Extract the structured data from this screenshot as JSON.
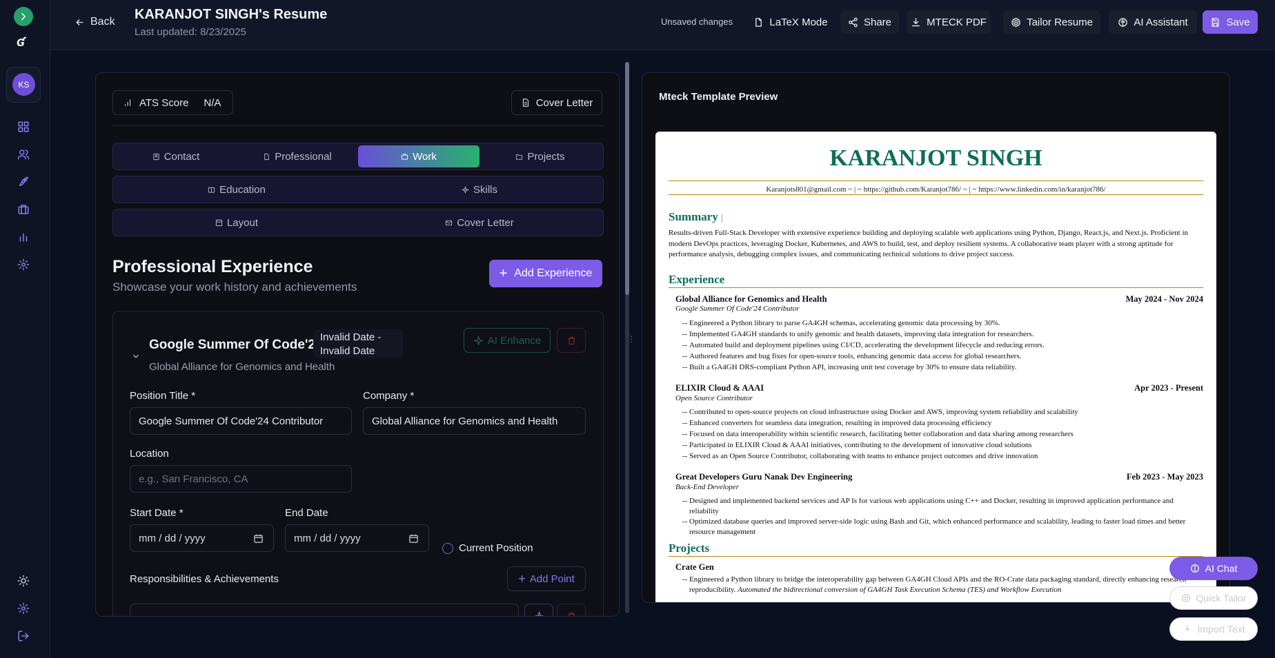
{
  "header": {
    "back_label": "Back",
    "title": "KARANJOT SINGH's Resume",
    "subtitle": "Last updated: 8/23/2025",
    "unsaved": "Unsaved changes",
    "latex_label": "LaTeX Mode",
    "share_label": "Share",
    "pdf_label": "MTECK PDF",
    "tailor_label": "Tailor Resume",
    "ai_label": "AI Assistant",
    "save_label": "Save"
  },
  "rail": {
    "avatar": "KS"
  },
  "editor": {
    "ats_label": "ATS Score",
    "ats_value": "N/A",
    "cover_letter_button": "Cover Letter",
    "tabs_row1": [
      "Contact",
      "Professional",
      "Work",
      "Projects"
    ],
    "tabs_row2": [
      "Education",
      "Skills"
    ],
    "tabs_row3": [
      "Layout",
      "Cover Letter"
    ],
    "active_tab": "Work",
    "section_title": "Professional Experience",
    "section_subtitle": "Showcase your work history and achievements",
    "add_experience": "Add Experience",
    "card": {
      "title": "Google Summer Of Code'24 ...",
      "subtitle": "Global Alliance for Genomics and Health",
      "date_range": "Invalid Date - Invalid Date",
      "ai_enhance": "AI Enhance",
      "position_label": "Position Title *",
      "position_value": "Google Summer Of Code'24 Contributor",
      "company_label": "Company *",
      "company_value": "Global Alliance for Genomics and Health",
      "location_label": "Location",
      "location_placeholder": "e.g., San Francisco, CA",
      "start_label": "Start Date *",
      "start_placeholder": "mm / dd / yyyy",
      "end_label": "End Date",
      "end_placeholder": "mm / dd / yyyy",
      "current_label": "Current Position",
      "resp_label": "Responsibilities & Achievements",
      "add_point": "Add Point"
    }
  },
  "preview": {
    "title": "Mteck Template Preview",
    "name": "KARANJOT SINGH",
    "contact": "Karanjots801@gmail.com ~ | ~ https://github.com/Karanjot786/ ~ | ~ https://www.linkedin.com/in/karanjot786/",
    "summary_heading": "Summary",
    "summary": "Results-driven Full-Stack Developer with extensive experience building and deploying scalable web applications using Python, Django, React.js, and Next.js. Proficient in modern DevOps practices, leveraging Docker, Kubernetes, and AWS to build, test, and deploy resilient systems. A collaborative team player with a strong aptitude for performance analysis, debugging complex issues, and communicating technical solutions to drive project success.",
    "experience_heading": "Experience",
    "jobs": [
      {
        "org": "Global Alliance for Genomics and Health",
        "dates": "May 2024 - Nov 2024",
        "role": "Google Summer Of Code'24 Contributor",
        "bullets": [
          "Engineered a Python library to parse GA4GH schemas, accelerating genomic data processing by 30%.",
          "Implemented GA4GH standards to unify genomic and health datasets, improving data integration for researchers.",
          "Automated build and deployment pipelines using CI/CD, accelerating the development lifecycle and reducing errors.",
          "Authored features and bug fixes for open-source tools, enhancing genomic data access for global researchers.",
          "Built a GA4GH DRS-compliant Python API, increasing unit test coverage by 30% to ensure data reliability."
        ]
      },
      {
        "org": "ELIXIR Cloud & AAAI",
        "dates": "Apr 2023 - Present",
        "role": "Open Source Contributor",
        "bullets": [
          "Contributed to open-source projects on cloud infrastructure using Docker and AWS, improving system reliability and scalability",
          "Enhanced converters for seamless data integration, resulting in improved data processing efficiency",
          "Focused on data interoperability within scientific research, facilitating better collaboration and data sharing among researchers",
          "Participated in ELIXIR Cloud & AAAI initiatives, contributing to the development of innovative cloud solutions",
          "Served as an Open Source Contributor, collaborating with teams to enhance project outcomes and drive innovation"
        ]
      },
      {
        "org": "Great Developers Guru Nanak Dev Engineering",
        "dates": "Feb 2023 - May 2023",
        "role": "Back-End Developer",
        "bullets": [
          "Designed and implemented backend services and AP Is for various web applications using C++ and Docker, resulting in improved application performance and reliability",
          "Optimized database queries and improved server-side logic using Bash and Git, which enhanced performance and scalability, leading to faster load times and better resource management"
        ]
      }
    ],
    "projects_heading": "Projects",
    "project_name": "Crate Gen",
    "project_bullet_1": "Engineered a Python library to bridge the interoperability gap between GA4GH Cloud APIs and the RO-Crate data packaging standard, directly enhancing research reproducibility.",
    "project_bullet_2": "Automated the bidirectional conversion of GA4GH Task Execution Schema (TES) and Workflow Execution"
  },
  "floating": {
    "ai_chat": "AI Chat",
    "quick_tailor": "Quick Tailor",
    "import_text": "Import Text"
  },
  "colors": {
    "accent": "#7c5ce6",
    "success": "#27b26b",
    "resume_heading": "#0e6e58",
    "rule": "#b8860b"
  }
}
